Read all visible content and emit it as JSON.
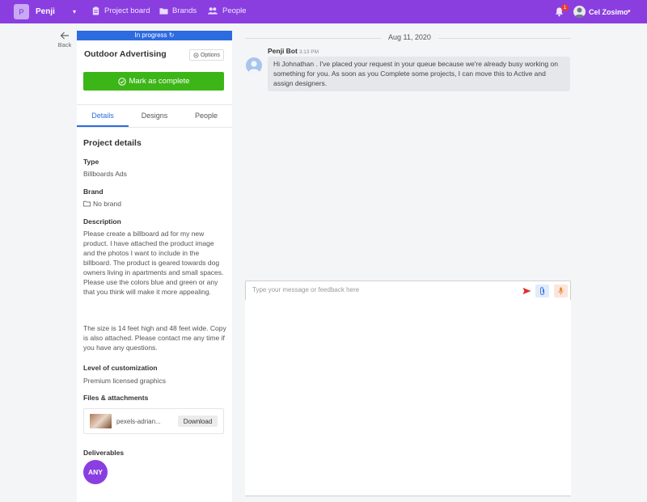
{
  "topbar": {
    "logo_letter": "P",
    "brand": "Penji",
    "nav": [
      {
        "label": "Project board",
        "icon": "clipboard-icon"
      },
      {
        "label": "Brands",
        "icon": "folder-icon"
      },
      {
        "label": "People",
        "icon": "people-icon"
      }
    ],
    "notification_count": "1",
    "username": "Cel Zosimo"
  },
  "back": {
    "label": "Back"
  },
  "project": {
    "status": "In progress ↻",
    "title": "Outdoor Advertising",
    "options_label": "Options",
    "complete_label": "Mark as complete",
    "tabs": [
      "Details",
      "Designs",
      "People"
    ],
    "active_tab": "Details"
  },
  "details": {
    "section_title": "Project details",
    "type_label": "Type",
    "type_value": "Billboards Ads",
    "brand_label": "Brand",
    "brand_value": "No brand",
    "description_label": "Description",
    "description_p1": "Please create a billboard ad for my new product. I have attached the product image and the photos I want to include in the billboard. The product is geared towards dog owners living in apartments and small spaces. Please use the colors blue and green or any that you think will make it more appealing.",
    "description_p2": "The size is 14 feet high and 48 feet wide. Copy is also attached. Please contact me any time if you have any questions.",
    "customization_label": "Level of customization",
    "customization_value": "Premium licensed graphics",
    "files_label": "Files & attachments",
    "file_name": "pexels-adrian...",
    "download_label": "Download",
    "deliverables_label": "Deliverables",
    "deliverable_value": "ANY"
  },
  "chat": {
    "date": "Aug 11, 2020",
    "sender": "Penji Bot",
    "time": "3:13 PM",
    "message": "Hi Johnathan . I've placed your request in your queue because we're already busy working on something for you. As soon as you Complete some projects, I can move this to Active and assign designers.",
    "placeholder": "Type your message or feedback here"
  },
  "colors": {
    "topbar": "#8a3ee0",
    "status": "#2d6be0",
    "complete": "#3cb517",
    "tab_active": "#2d6be0"
  }
}
